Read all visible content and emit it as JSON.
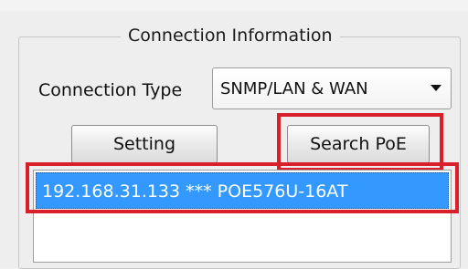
{
  "group": {
    "title": "Connection Information"
  },
  "connection": {
    "label": "Connection Type",
    "selected": "SNMP/LAN & WAN"
  },
  "buttons": {
    "setting": "Setting",
    "search": "Search PoE"
  },
  "device_list": {
    "items": [
      "192.168.31.133 *** POE576U-16AT"
    ]
  },
  "colors": {
    "highlight_box": "#d9202a",
    "selection": "#3399ff"
  }
}
